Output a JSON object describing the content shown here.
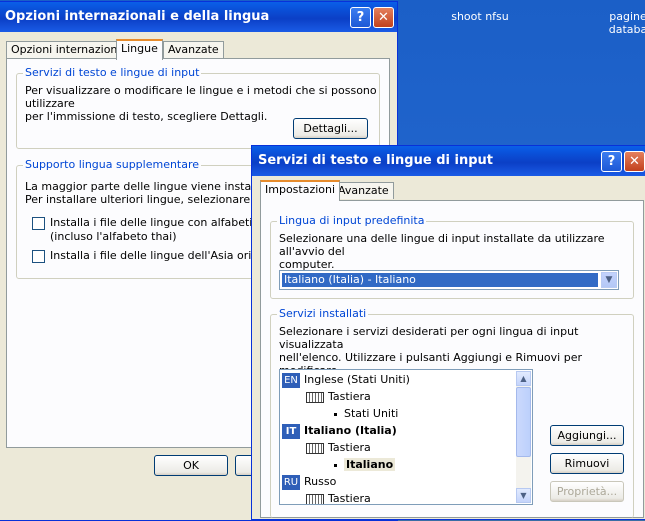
{
  "desktop": {
    "icons": [
      {
        "label": "shoot nfsu"
      },
      {
        "label": "pagine\ndataba"
      }
    ]
  },
  "win1": {
    "title": "Opzioni internazionali e della lingua",
    "tabs": [
      {
        "label": "Opzioni internazionali"
      },
      {
        "label": "Lingue"
      },
      {
        "label": "Avanzate"
      }
    ],
    "group1": {
      "label": "Servizi di testo e lingue di input",
      "text": "Per visualizzare o modificare le lingue e i metodi che si possono utilizzare\nper l'immissione di testo, scegliere Dettagli.",
      "button": "Dettagli..."
    },
    "group2": {
      "label": "Supporto lingua supplementare",
      "text": "La maggior parte delle lingue viene installata per\nPer installare ulteriori lingue, selezionare la relativ",
      "check1_line1": "Installa i file delle lingue con alfabeti non lat",
      "check1_line2": "(incluso l'alfabeto thai)",
      "check2": "Installa i file delle lingue dell'Asia orientale"
    },
    "ok_label": "OK"
  },
  "win2": {
    "title": "Servizi di testo e lingue di input",
    "tabs": [
      {
        "label": "Impostazioni"
      },
      {
        "label": "Avanzate"
      }
    ],
    "group1": {
      "label": "Lingua di input predefinita",
      "text": "Selezionare una delle lingue di input installate da utilizzare all'avvio del\ncomputer.",
      "selected": "Italiano (Italia) - Italiano"
    },
    "group2": {
      "label": "Servizi installati",
      "text": "Selezionare i servizi desiderati per ogni lingua di input visualizzata\nnell'elenco. Utilizzare i pulsanti Aggiungi e Rimuovi per modificare\nl'elenco.",
      "tree": [
        {
          "badge": "EN",
          "label": "Inglese (Stati Uniti)"
        },
        {
          "label": "Tastiera"
        },
        {
          "label": "Stati Uniti"
        },
        {
          "badge": "IT",
          "label": "Italiano (Italia)"
        },
        {
          "label": "Tastiera"
        },
        {
          "label": "Italiano"
        },
        {
          "badge": "RU",
          "label": "Russo"
        },
        {
          "label": "Tastiera"
        }
      ],
      "add_label": "Aggiungi...",
      "remove_label": "Rimuovi",
      "properties_label": "Proprietà..."
    }
  }
}
